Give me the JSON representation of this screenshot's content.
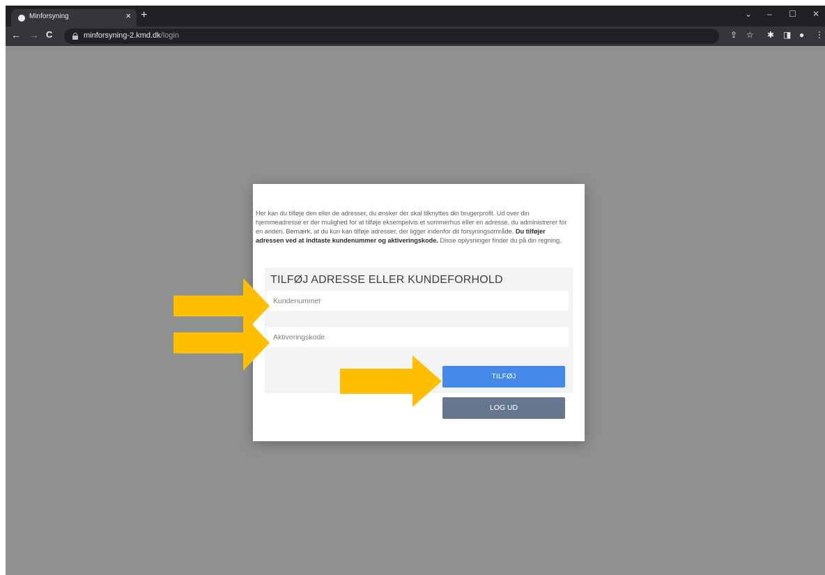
{
  "browser": {
    "tab_title": "Minforsyning",
    "tab_close": "×",
    "new_tab": "+",
    "url_host": "minforsyning-2.kmd.dk",
    "url_path": "/login",
    "window_controls": {
      "dropdown": "⌄",
      "minimize": "–",
      "maximize": "☐",
      "close": "✕"
    },
    "nav": {
      "back": "←",
      "forward": "→",
      "reload": "C"
    },
    "toolbar_icons": {
      "share": "⇪",
      "bookmark": "☆",
      "extensions": "✱",
      "side_panel": "◨",
      "profile": "●",
      "menu": "⋮"
    }
  },
  "dialog": {
    "intro_text_1": "Her kan du tilføje den eller de adresser, du ønsker der skal tilknyttes din brugerprofil. Ud over din hjemmeadresse er der mulighed for at tilføje eksempelvis et sommerhus eller en adresse, du administrerer for en anden. Bemærk, at du kun kan tilføje adresser, der ligger indenfor dit forsyningsområde. ",
    "intro_text_bold": "Du tilføjer adressen ved at indtaste kundenummer og aktiveringskode.",
    "intro_text_2": " Disse oplysninger finder du på din regning.",
    "form_title": "TILFØJ ADRESSE ELLER KUNDEFORHOLD",
    "customer_number_placeholder": "Kundenummer",
    "activation_code_placeholder": "Aktiveringskode",
    "add_button": "TILFØJ",
    "logout_button": "LOG UD"
  },
  "colors": {
    "page_background": "#8f9090",
    "primary_button": "#4488ea",
    "secondary_button": "#67778f",
    "annotation_arrow": "#ffbf00"
  },
  "icons": [
    "globe-favicon-icon",
    "lock-icon",
    "share-icon",
    "star-icon",
    "puzzle-icon",
    "side-panel-icon",
    "profile-icon",
    "kebab-menu-icon",
    "arrow-annotation-icon"
  ]
}
